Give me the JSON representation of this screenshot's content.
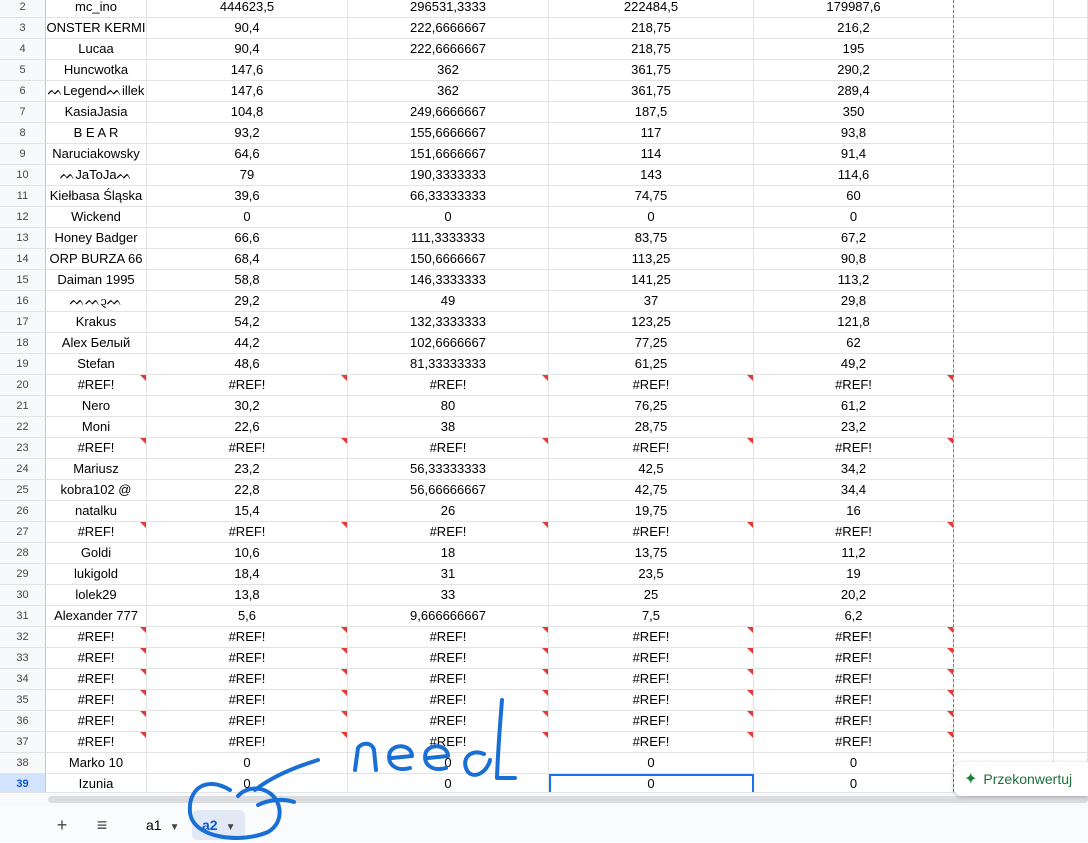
{
  "rows": [
    {
      "num": "2",
      "name": "mc_ino",
      "v1": "444623,5",
      "v2": "296531,3333",
      "v3": "222484,5",
      "v4": "179987,6"
    },
    {
      "num": "3",
      "name": "ONSTER KERMI",
      "v1": "90,4",
      "v2": "222,6666667",
      "v3": "218,75",
      "v4": "216,2"
    },
    {
      "num": "4",
      "name": "Lucaa",
      "v1": "90,4",
      "v2": "222,6666667",
      "v3": "218,75",
      "v4": "195"
    },
    {
      "num": "5",
      "name": "Huncwotka",
      "v1": "147,6",
      "v2": "362",
      "v3": "361,75",
      "v4": "290,2"
    },
    {
      "num": "6",
      "name": "ᨓLegendᨓillek",
      "v1": "147,6",
      "v2": "362",
      "v3": "361,75",
      "v4": "289,4"
    },
    {
      "num": "7",
      "name": "KasiaJasia",
      "v1": "104,8",
      "v2": "249,6666667",
      "v3": "187,5",
      "v4": "350"
    },
    {
      "num": "8",
      "name": "B E A R",
      "v1": "93,2",
      "v2": "155,6666667",
      "v3": "117",
      "v4": "93,8"
    },
    {
      "num": "9",
      "name": "Naruciakowsky",
      "v1": "64,6",
      "v2": "151,6666667",
      "v3": "114",
      "v4": "91,4"
    },
    {
      "num": "10",
      "name": "ᨓJaToJaᨓ",
      "v1": "79",
      "v2": "190,3333333",
      "v3": "143",
      "v4": "114,6"
    },
    {
      "num": "11",
      "name": "Kiełbasa Śląska",
      "v1": "39,6",
      "v2": "66,33333333",
      "v3": "74,75",
      "v4": "60"
    },
    {
      "num": "12",
      "name": "Wickend",
      "v1": "0",
      "v2": "0",
      "v3": "0",
      "v4": "0"
    },
    {
      "num": "13",
      "name": "Honey Badger",
      "v1": "66,6",
      "v2": "111,3333333",
      "v3": "83,75",
      "v4": "67,2"
    },
    {
      "num": "14",
      "name": "ORP BURZA 66",
      "v1": "68,4",
      "v2": "150,6666667",
      "v3": "113,25",
      "v4": "90,8"
    },
    {
      "num": "15",
      "name": "Daiman 1995",
      "v1": "58,8",
      "v2": "146,3333333",
      "v3": "141,25",
      "v4": "113,2"
    },
    {
      "num": "16",
      "name": "ᨓᨓ᧓ᨓ",
      "v1": "29,2",
      "v2": "49",
      "v3": "37",
      "v4": "29,8"
    },
    {
      "num": "17",
      "name": "Krakus",
      "v1": "54,2",
      "v2": "132,3333333",
      "v3": "123,25",
      "v4": "121,8"
    },
    {
      "num": "18",
      "name": "Alex Белый",
      "v1": "44,2",
      "v2": "102,6666667",
      "v3": "77,25",
      "v4": "62"
    },
    {
      "num": "19",
      "name": "Stefan",
      "v1": "48,6",
      "v2": "81,33333333",
      "v3": "61,25",
      "v4": "49,2"
    },
    {
      "num": "20",
      "name": "#REF!",
      "v1": "#REF!",
      "v2": "#REF!",
      "v3": "#REF!",
      "v4": "#REF!",
      "err": true
    },
    {
      "num": "21",
      "name": "Nero",
      "v1": "30,2",
      "v2": "80",
      "v3": "76,25",
      "v4": "61,2"
    },
    {
      "num": "22",
      "name": "Moni",
      "v1": "22,6",
      "v2": "38",
      "v3": "28,75",
      "v4": "23,2"
    },
    {
      "num": "23",
      "name": "#REF!",
      "v1": "#REF!",
      "v2": "#REF!",
      "v3": "#REF!",
      "v4": "#REF!",
      "err": true
    },
    {
      "num": "24",
      "name": "Mariusz",
      "v1": "23,2",
      "v2": "56,33333333",
      "v3": "42,5",
      "v4": "34,2"
    },
    {
      "num": "25",
      "name": "kobra102 @",
      "v1": "22,8",
      "v2": "56,66666667",
      "v3": "42,75",
      "v4": "34,4"
    },
    {
      "num": "26",
      "name": "natalku",
      "v1": "15,4",
      "v2": "26",
      "v3": "19,75",
      "v4": "16"
    },
    {
      "num": "27",
      "name": "#REF!",
      "v1": "#REF!",
      "v2": "#REF!",
      "v3": "#REF!",
      "v4": "#REF!",
      "err": true
    },
    {
      "num": "28",
      "name": "Goldi",
      "v1": "10,6",
      "v2": "18",
      "v3": "13,75",
      "v4": "11,2"
    },
    {
      "num": "29",
      "name": "lukigold",
      "v1": "18,4",
      "v2": "31",
      "v3": "23,5",
      "v4": "19"
    },
    {
      "num": "30",
      "name": "lolek29",
      "v1": "13,8",
      "v2": "33",
      "v3": "25",
      "v4": "20,2"
    },
    {
      "num": "31",
      "name": "Alexander 777",
      "v1": "5,6",
      "v2": "9,666666667",
      "v3": "7,5",
      "v4": "6,2"
    },
    {
      "num": "32",
      "name": "#REF!",
      "v1": "#REF!",
      "v2": "#REF!",
      "v3": "#REF!",
      "v4": "#REF!",
      "err": true
    },
    {
      "num": "33",
      "name": "#REF!",
      "v1": "#REF!",
      "v2": "#REF!",
      "v3": "#REF!",
      "v4": "#REF!",
      "err": true
    },
    {
      "num": "34",
      "name": "#REF!",
      "v1": "#REF!",
      "v2": "#REF!",
      "v3": "#REF!",
      "v4": "#REF!",
      "err": true
    },
    {
      "num": "35",
      "name": "#REF!",
      "v1": "#REF!",
      "v2": "#REF!",
      "v3": "#REF!",
      "v4": "#REF!",
      "err": true
    },
    {
      "num": "36",
      "name": "#REF!",
      "v1": "#REF!",
      "v2": "#REF!",
      "v3": "#REF!",
      "v4": "#REF!",
      "err": true
    },
    {
      "num": "37",
      "name": "#REF!",
      "v1": "#REF!",
      "v2": "#REF!",
      "v3": "#REF!",
      "v4": "#REF!",
      "err": true
    },
    {
      "num": "38",
      "name": "Marko 10",
      "v1": "0",
      "v2": "0",
      "v3": "0",
      "v4": "0"
    },
    {
      "num": "39",
      "name": "Izunia",
      "v1": "0",
      "v2": "0",
      "v3": "0",
      "v4": "0",
      "active": true
    }
  ],
  "sheetbar": {
    "add_icon": "plus-icon",
    "all_sheets_icon": "menu-icon",
    "tabs": [
      {
        "label": "a1"
      },
      {
        "label": "a2",
        "active": true
      }
    ],
    "add_glyph": "+",
    "menu_glyph": "≡",
    "caret_glyph": "▼"
  },
  "convert_button": {
    "label": "Przekonwertuj",
    "icon": "sparkle-icon",
    "glyph": "✦"
  },
  "annotation": {
    "text": "need",
    "color": "#1a6fd4"
  },
  "colors": {
    "error_marker": "#e53935",
    "selection": "#1a73e8",
    "page_break": "#34a853",
    "active_tab": "#0b57d0"
  }
}
